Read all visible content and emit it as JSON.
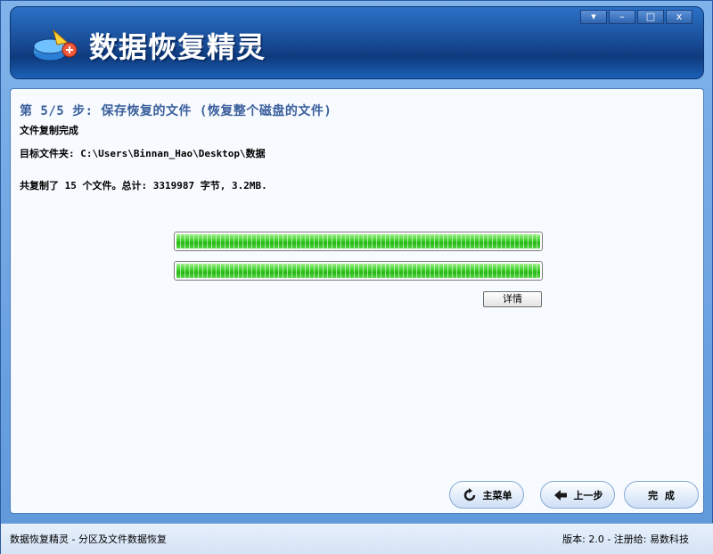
{
  "window": {
    "title": "数据恢复精灵",
    "controls": {
      "menu": "▾",
      "minimize": "–",
      "maximize": "□",
      "close": "x"
    }
  },
  "step": {
    "title": "第 5/5 步: 保存恢复的文件 (恢复整个磁盘的文件)",
    "status": "文件复制完成",
    "target_folder": "目标文件夹: C:\\Users\\Binnan_Hao\\Desktop\\数据",
    "summary": "共复制了 15 个文件。总计: 3319987 字节, 3.2MB."
  },
  "progress": [
    {
      "name": "current-file",
      "percent": 100
    },
    {
      "name": "overall",
      "percent": 100
    }
  ],
  "buttons": {
    "details": "详情",
    "main_menu": "主菜单",
    "previous": "上一步",
    "finish": "完  成"
  },
  "statusbar": {
    "left": "数据恢复精灵 - 分区及文件数据恢复",
    "right": "版本: 2.0 - 注册给: 易数科技"
  },
  "colors": {
    "accent": "#3b5f9c",
    "progress_fill": "#3ecf2a",
    "banner": "#1a4f9a"
  },
  "icons": {
    "logo": "disk-recovery-logo-icon",
    "main_menu": "refresh-icon",
    "previous": "arrow-left-icon"
  }
}
